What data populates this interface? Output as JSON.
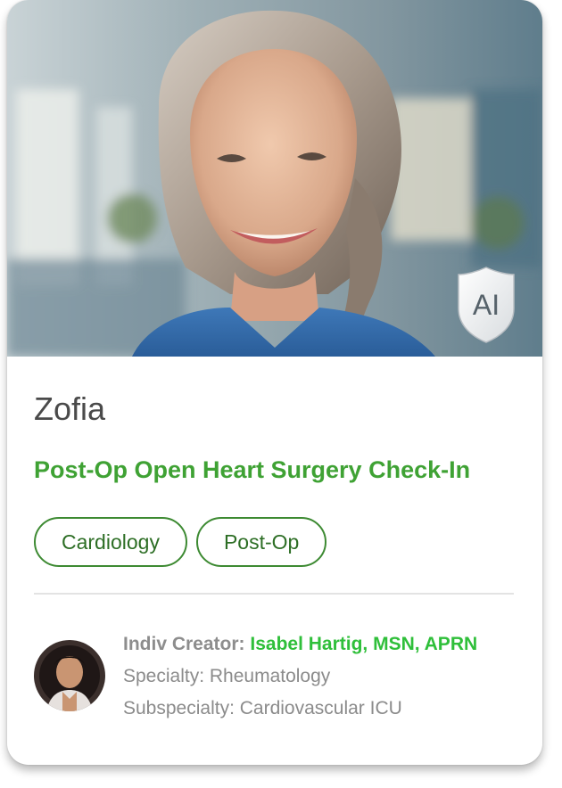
{
  "persona": {
    "name": "Zofia",
    "title": "Post-Op Open Heart Surgery Check-In",
    "ai_badge": "AI",
    "tags": [
      "Cardiology",
      "Post-Op"
    ]
  },
  "creator": {
    "label": "Indiv Creator:",
    "name": "Isabel Hartig, MSN, APRN",
    "specialty": "Specialty: Rheumatology",
    "subspecialty": "Subspecialty: Cardiovascular ICU"
  },
  "colors": {
    "accent_green": "#3fa234",
    "creator_name_green": "#2fbf3a",
    "tag_border": "#3d8a32"
  }
}
